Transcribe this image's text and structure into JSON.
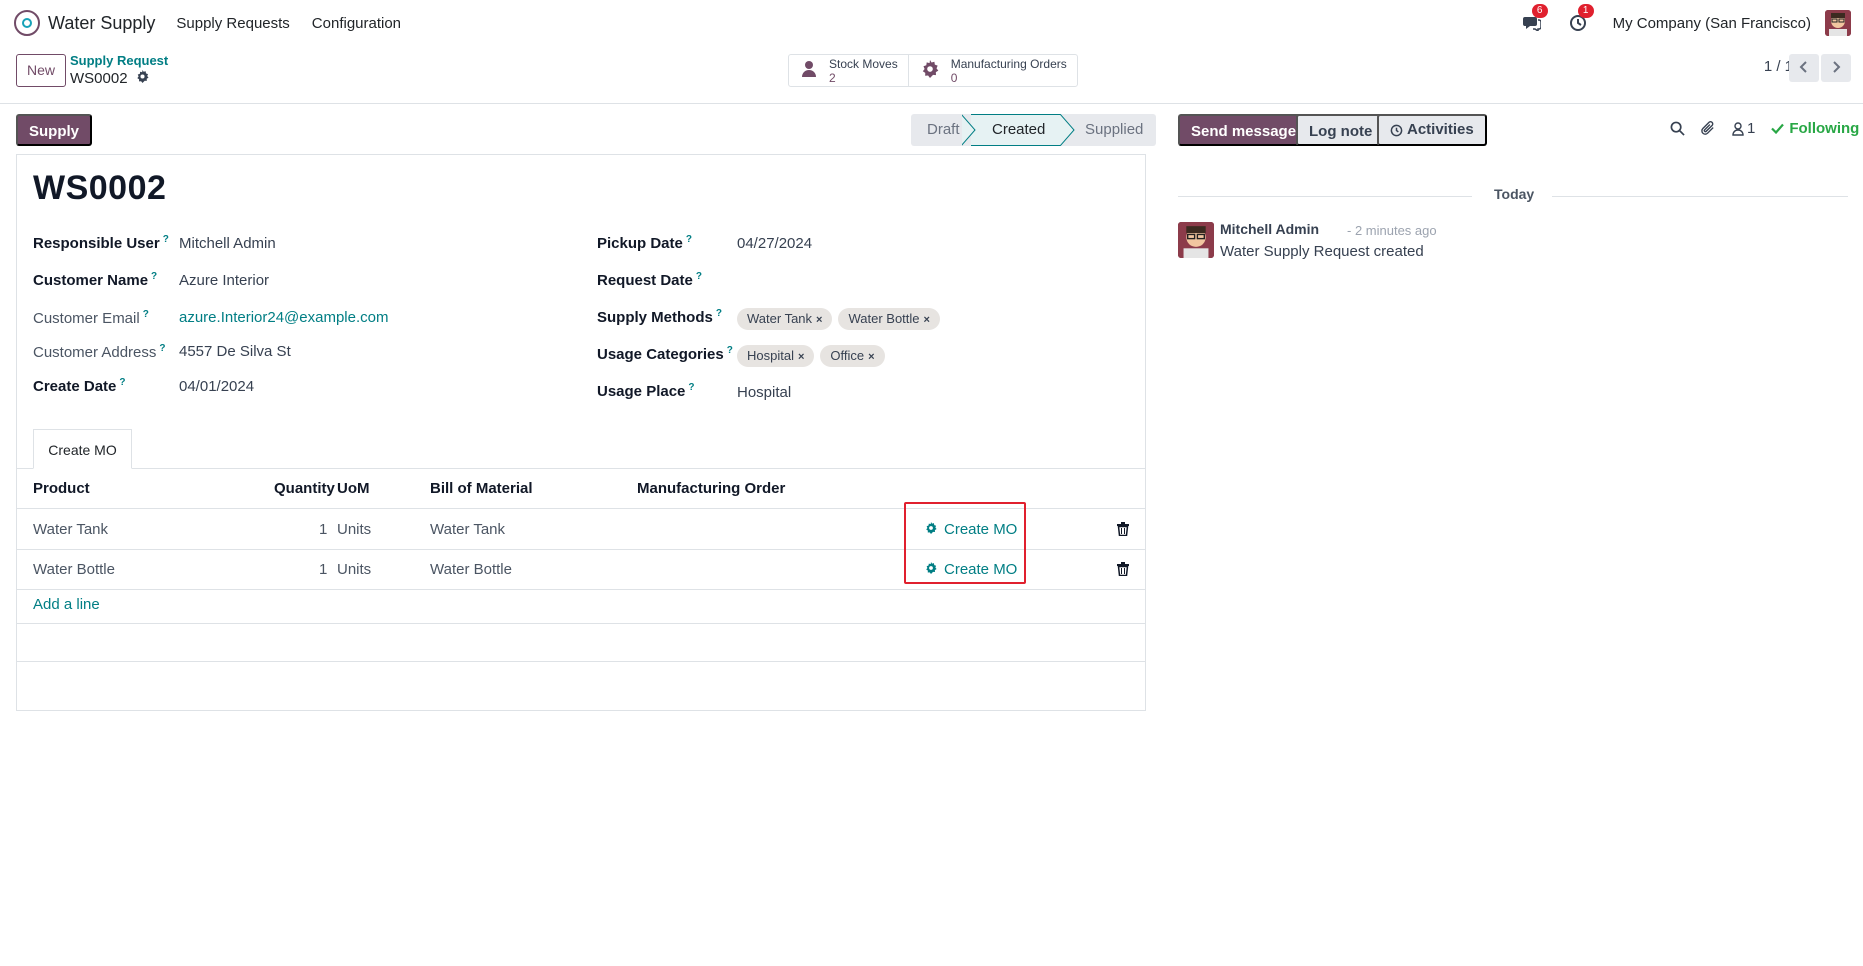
{
  "navbar": {
    "app_name": "Water Supply",
    "menus": [
      "Supply Requests",
      "Configuration"
    ],
    "messages_badge": "6",
    "activities_badge": "1",
    "company": "My Company (San Francisco)"
  },
  "control_panel": {
    "new_label": "New",
    "breadcrumb_parent": "Supply Request",
    "breadcrumb_current": "WS0002",
    "smart_buttons": [
      {
        "label": "Stock Moves",
        "value": "2",
        "icon": "truck-icon"
      },
      {
        "label": "Manufacturing Orders",
        "value": "0",
        "icon": "gear-icon"
      }
    ],
    "pager": "1 / 1"
  },
  "actions": {
    "supply_label": "Supply"
  },
  "statusbar": {
    "stages": [
      "Draft",
      "Created",
      "Supplied"
    ],
    "current": "Created"
  },
  "form": {
    "title": "WS0002",
    "left_fields": [
      {
        "label": "Responsible User",
        "value": "Mitchell Admin"
      },
      {
        "label": "Customer Name",
        "value": "Azure Interior"
      },
      {
        "label": "Customer Email",
        "value": "azure.Interior24@example.com"
      },
      {
        "label": "Customer Address",
        "value": "4557 De Silva St"
      },
      {
        "label": "Create Date",
        "value": "04/01/2024"
      }
    ],
    "right_fields": [
      {
        "label": "Pickup Date",
        "value": "04/27/2024"
      },
      {
        "label": "Request Date",
        "value": ""
      },
      {
        "label": "Supply Methods",
        "tags": [
          "Water Tank",
          "Water Bottle"
        ]
      },
      {
        "label": "Usage Categories",
        "tags": [
          "Hospital",
          "Office"
        ]
      },
      {
        "label": "Usage Place",
        "value": "Hospital"
      }
    ],
    "help_mark": "?",
    "tab": "Create MO",
    "table": {
      "columns": [
        "Product",
        "Quantity",
        "UoM",
        "Bill of Material",
        "Manufacturing Order"
      ],
      "rows": [
        {
          "product": "Water Tank",
          "quantity": "1",
          "uom": "Units",
          "bom": "Water Tank",
          "mo": "",
          "action": "Create MO"
        },
        {
          "product": "Water Bottle",
          "quantity": "1",
          "uom": "Units",
          "bom": "Water Bottle",
          "mo": "",
          "action": "Create MO"
        }
      ],
      "add_line": "Add a line"
    }
  },
  "chatter": {
    "send_message": "Send message",
    "log_note": "Log note",
    "activities": "Activities",
    "followers_count": "1",
    "following": "Following",
    "separator": "Today",
    "messages": [
      {
        "author": "Mitchell Admin",
        "time": "- 2 minutes ago",
        "body": "Water Supply Request created"
      }
    ]
  },
  "colors": {
    "brand": "#714B67",
    "link": "#017e84",
    "success": "#28a745",
    "highlight": "#e0202e"
  }
}
